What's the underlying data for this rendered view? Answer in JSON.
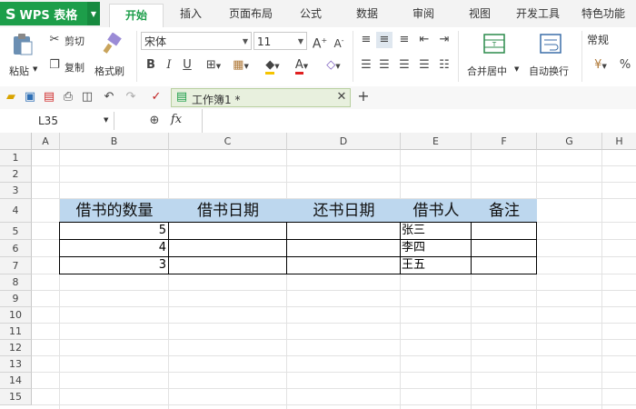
{
  "app": {
    "name": "WPS 表格"
  },
  "tabs": [
    "开始",
    "插入",
    "页面布局",
    "公式",
    "数据",
    "审阅",
    "视图",
    "开发工具",
    "特色功能"
  ],
  "ribbon": {
    "paste": "粘贴",
    "cut": "剪切",
    "copy": "复制",
    "format_painter": "格式刷",
    "font_name": "宋体",
    "font_size": "11",
    "merge_center": "合并居中",
    "wrap_text": "自动换行",
    "number_format": "常规"
  },
  "document": {
    "tab_title": "工作簿1 *"
  },
  "formula_bar": {
    "name_box": "L35",
    "fx": "fx",
    "value": ""
  },
  "sheet": {
    "columns": [
      "A",
      "B",
      "C",
      "D",
      "E",
      "F",
      "G",
      "H"
    ],
    "rows": [
      "1",
      "2",
      "3",
      "4",
      "5",
      "6",
      "7",
      "8",
      "9",
      "10",
      "11",
      "12",
      "13",
      "14",
      "15"
    ],
    "headers": [
      "借书的数量",
      "借书日期",
      "还书日期",
      "借书人",
      "备注"
    ],
    "data": [
      [
        "5",
        "",
        "",
        "张三",
        ""
      ],
      [
        "4",
        "",
        "",
        "李四",
        ""
      ],
      [
        "3",
        "",
        "",
        "王五",
        ""
      ]
    ]
  },
  "colors": {
    "brand": "#1d9e4a",
    "header_fill": "#bdd7ee"
  }
}
